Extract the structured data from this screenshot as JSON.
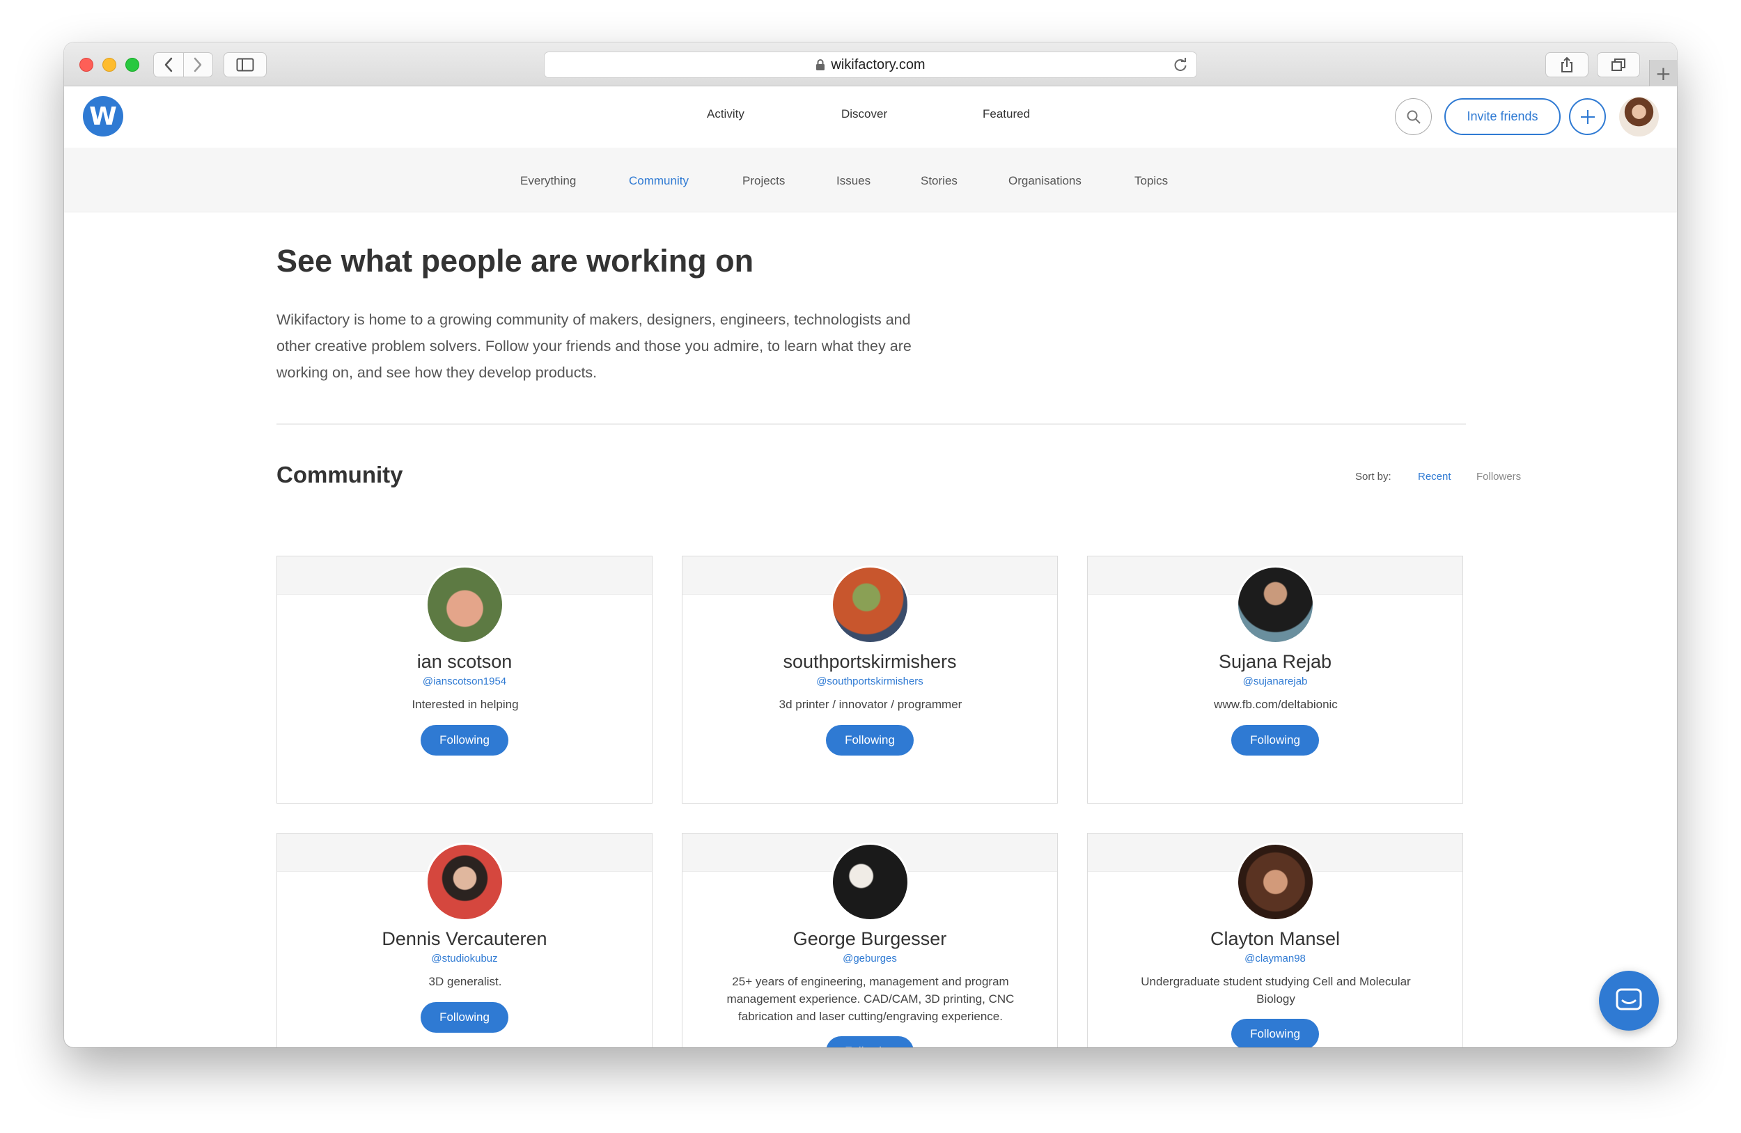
{
  "browser": {
    "url": "wikifactory.com",
    "new_tab_label": "+"
  },
  "header": {
    "logo_letter": "W",
    "nav": [
      "Activity",
      "Discover",
      "Featured"
    ],
    "invite_label": "Invite friends"
  },
  "subnav": {
    "items": [
      "Everything",
      "Community",
      "Projects",
      "Issues",
      "Stories",
      "Organisations",
      "Topics"
    ],
    "active": "Community"
  },
  "main": {
    "title": "See what people are working on",
    "intro": "Wikifactory is home to a growing community of makers, designers, engineers, technologists and other creative problem solvers. Follow your friends and those you admire, to learn what they are working on, and see how they develop products.",
    "section_title": "Community",
    "sort": {
      "label": "Sort by:",
      "options": [
        "Recent",
        "Followers"
      ],
      "selected": "Recent"
    }
  },
  "users": [
    {
      "name": "ian scotson",
      "handle": "@ianscotson1954",
      "bio": "Interested in helping",
      "button": "Following"
    },
    {
      "name": "southportskirmishers",
      "handle": "@southportskirmishers",
      "bio": "3d printer / innovator / programmer",
      "button": "Following"
    },
    {
      "name": "Sujana Rejab",
      "handle": "@sujanarejab",
      "bio": "www.fb.com/deltabionic",
      "button": "Following"
    },
    {
      "name": "Dennis Vercauteren",
      "handle": "@studiokubuz",
      "bio": "3D generalist.",
      "button": "Following"
    },
    {
      "name": "George Burgesser",
      "handle": "@geburges",
      "bio": "25+ years of engineering, management and program management experience. CAD/CAM, 3D printing, CNC fabrication and laser cutting/engraving experience.",
      "button": "Following"
    },
    {
      "name": "Clayton Mansel",
      "handle": "@clayman98",
      "bio": "Undergraduate student studying Cell and Molecular Biology",
      "button": "Following"
    }
  ],
  "colors": {
    "accent": "#2f7ad3"
  },
  "icons": {
    "back": "chevron-left-icon",
    "forward": "chevron-right-icon",
    "sidebar": "sidebar-icon",
    "lock": "lock-icon",
    "reload": "reload-icon",
    "share": "share-icon",
    "tabs": "tabs-icon",
    "search": "search-icon",
    "plus": "plus-icon",
    "chat": "chat-icon"
  }
}
